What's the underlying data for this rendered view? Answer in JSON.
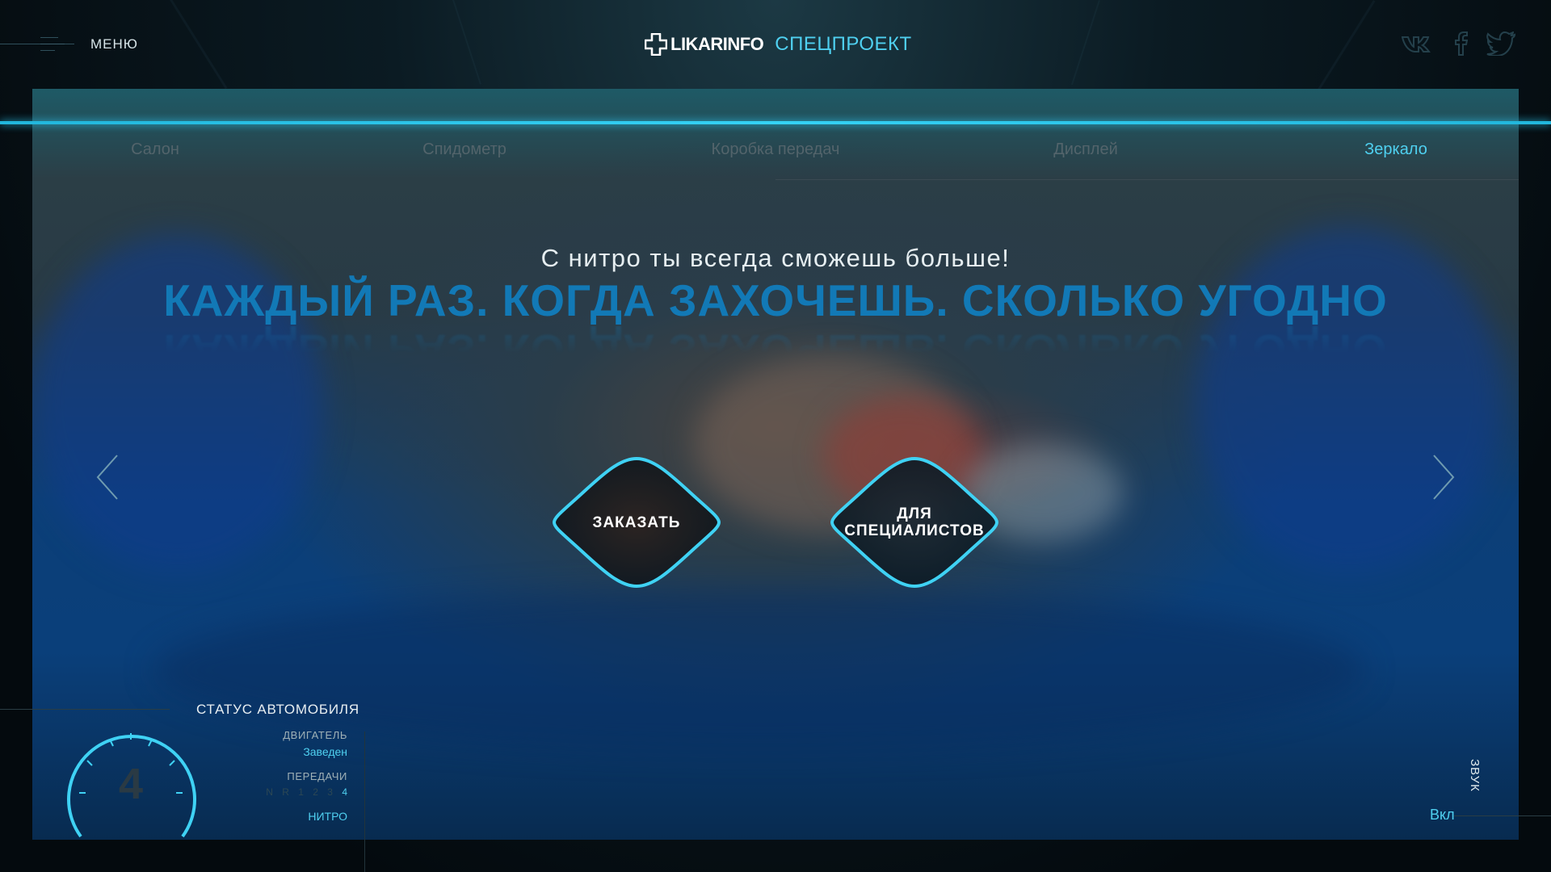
{
  "header": {
    "menu_label": "МЕНЮ",
    "brand_name": "LIKARINFO",
    "brand_special": "СПЕЦПРОЕКТ",
    "social_icons": [
      "vk-icon",
      "facebook-icon",
      "twitter-icon"
    ]
  },
  "nav": {
    "items": [
      {
        "label": "Салон",
        "active": false
      },
      {
        "label": "Спидометр",
        "active": false
      },
      {
        "label": "Коробка передач",
        "active": false
      },
      {
        "label": "Дисплей",
        "active": false
      },
      {
        "label": "Зеркало",
        "active": true
      }
    ]
  },
  "hero": {
    "tagline": "С нитро ты всегда сможешь больше!",
    "headline": "КАЖДЫЙ РАЗ. КОГДА ЗАХОЧЕШЬ. СКОЛЬКО УГОДНО"
  },
  "buttons": {
    "order_label": "ЗАКАЗАТЬ",
    "specialists_label_line1": "ДЛЯ",
    "specialists_label_line2": "СПЕЦИАЛИСТОВ"
  },
  "status": {
    "title": "СТАТУС АВТОМОБИЛЯ",
    "engine_label": "ДВИГАТЕЛЬ",
    "engine_value": "Заведен",
    "gears_label": "ПЕРЕДАЧИ",
    "gears_options": "N R 1 2 3",
    "gears_current": "4",
    "nitro_label": "НИТРО",
    "gauge_value": "4"
  },
  "sound": {
    "label": "ЗВУК",
    "value": "Вкл"
  },
  "colors": {
    "accent": "#4fd0f0",
    "headline": "#1279b6",
    "background": "#06121a"
  }
}
